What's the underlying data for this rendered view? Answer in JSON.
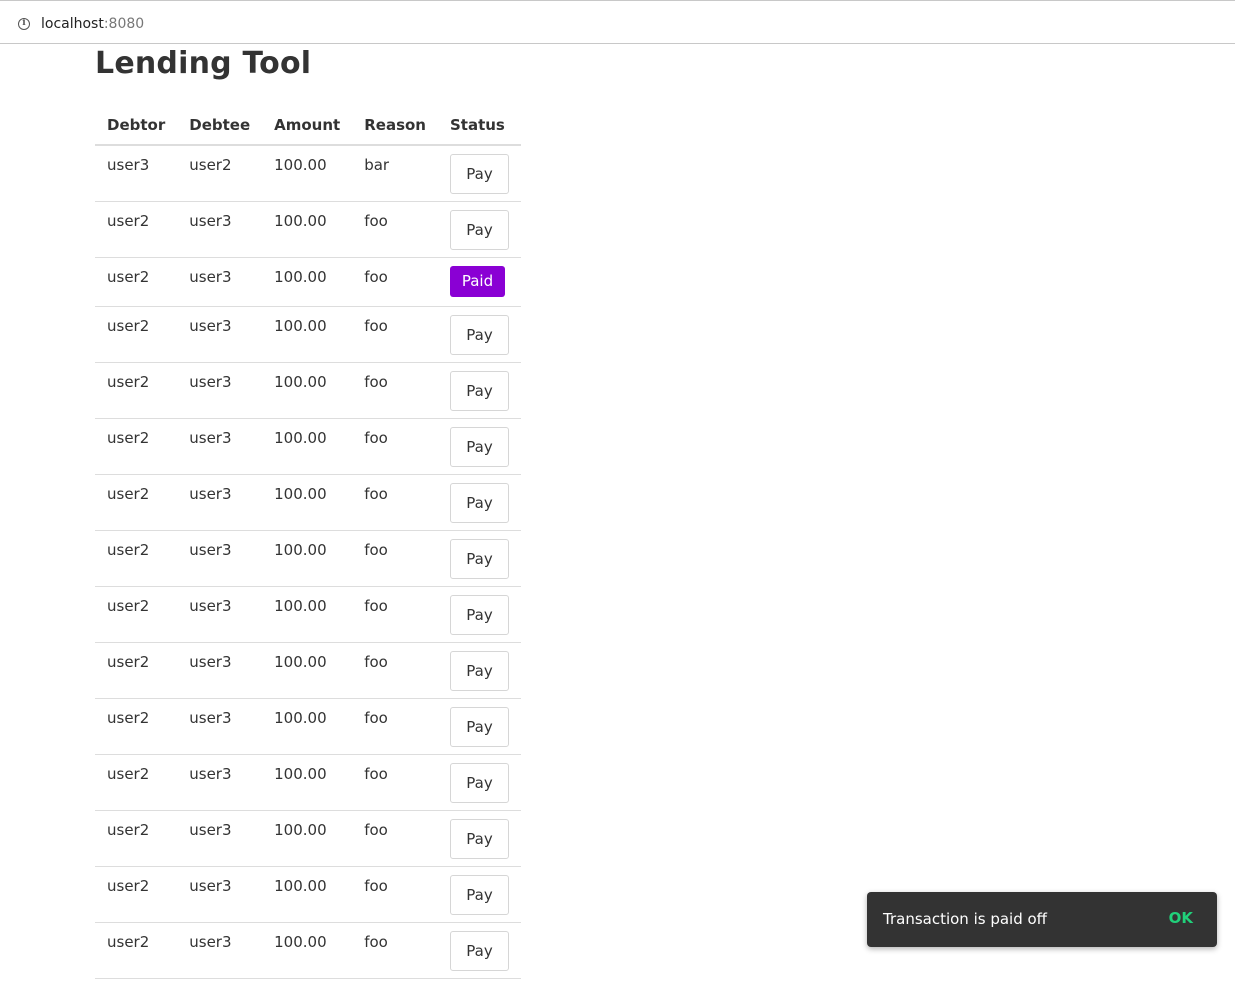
{
  "browser": {
    "info_icon": "info-icon",
    "url_host": "localhost",
    "url_port": ":8080"
  },
  "page": {
    "title": "Lending Tool"
  },
  "table": {
    "headers": [
      "Debtor",
      "Debtee",
      "Amount",
      "Reason",
      "Status"
    ],
    "rows": [
      {
        "debtor": "user3",
        "debtee": "user2",
        "amount": "100.00",
        "reason": "bar",
        "status": "Pay"
      },
      {
        "debtor": "user2",
        "debtee": "user3",
        "amount": "100.00",
        "reason": "foo",
        "status": "Pay"
      },
      {
        "debtor": "user2",
        "debtee": "user3",
        "amount": "100.00",
        "reason": "foo",
        "status": "Paid"
      },
      {
        "debtor": "user2",
        "debtee": "user3",
        "amount": "100.00",
        "reason": "foo",
        "status": "Pay"
      },
      {
        "debtor": "user2",
        "debtee": "user3",
        "amount": "100.00",
        "reason": "foo",
        "status": "Pay"
      },
      {
        "debtor": "user2",
        "debtee": "user3",
        "amount": "100.00",
        "reason": "foo",
        "status": "Pay"
      },
      {
        "debtor": "user2",
        "debtee": "user3",
        "amount": "100.00",
        "reason": "foo",
        "status": "Pay"
      },
      {
        "debtor": "user2",
        "debtee": "user3",
        "amount": "100.00",
        "reason": "foo",
        "status": "Pay"
      },
      {
        "debtor": "user2",
        "debtee": "user3",
        "amount": "100.00",
        "reason": "foo",
        "status": "Pay"
      },
      {
        "debtor": "user2",
        "debtee": "user3",
        "amount": "100.00",
        "reason": "foo",
        "status": "Pay"
      },
      {
        "debtor": "user2",
        "debtee": "user3",
        "amount": "100.00",
        "reason": "foo",
        "status": "Pay"
      },
      {
        "debtor": "user2",
        "debtee": "user3",
        "amount": "100.00",
        "reason": "foo",
        "status": "Pay"
      },
      {
        "debtor": "user2",
        "debtee": "user3",
        "amount": "100.00",
        "reason": "foo",
        "status": "Pay"
      },
      {
        "debtor": "user2",
        "debtee": "user3",
        "amount": "100.00",
        "reason": "foo",
        "status": "Pay"
      },
      {
        "debtor": "user2",
        "debtee": "user3",
        "amount": "100.00",
        "reason": "foo",
        "status": "Pay"
      }
    ]
  },
  "snackbar": {
    "message": "Transaction is paid off",
    "action": "OK"
  },
  "colors": {
    "paid_badge": "#8a00d4",
    "snackbar_bg": "#333333",
    "snackbar_action": "#21d07a",
    "text": "#333333"
  }
}
